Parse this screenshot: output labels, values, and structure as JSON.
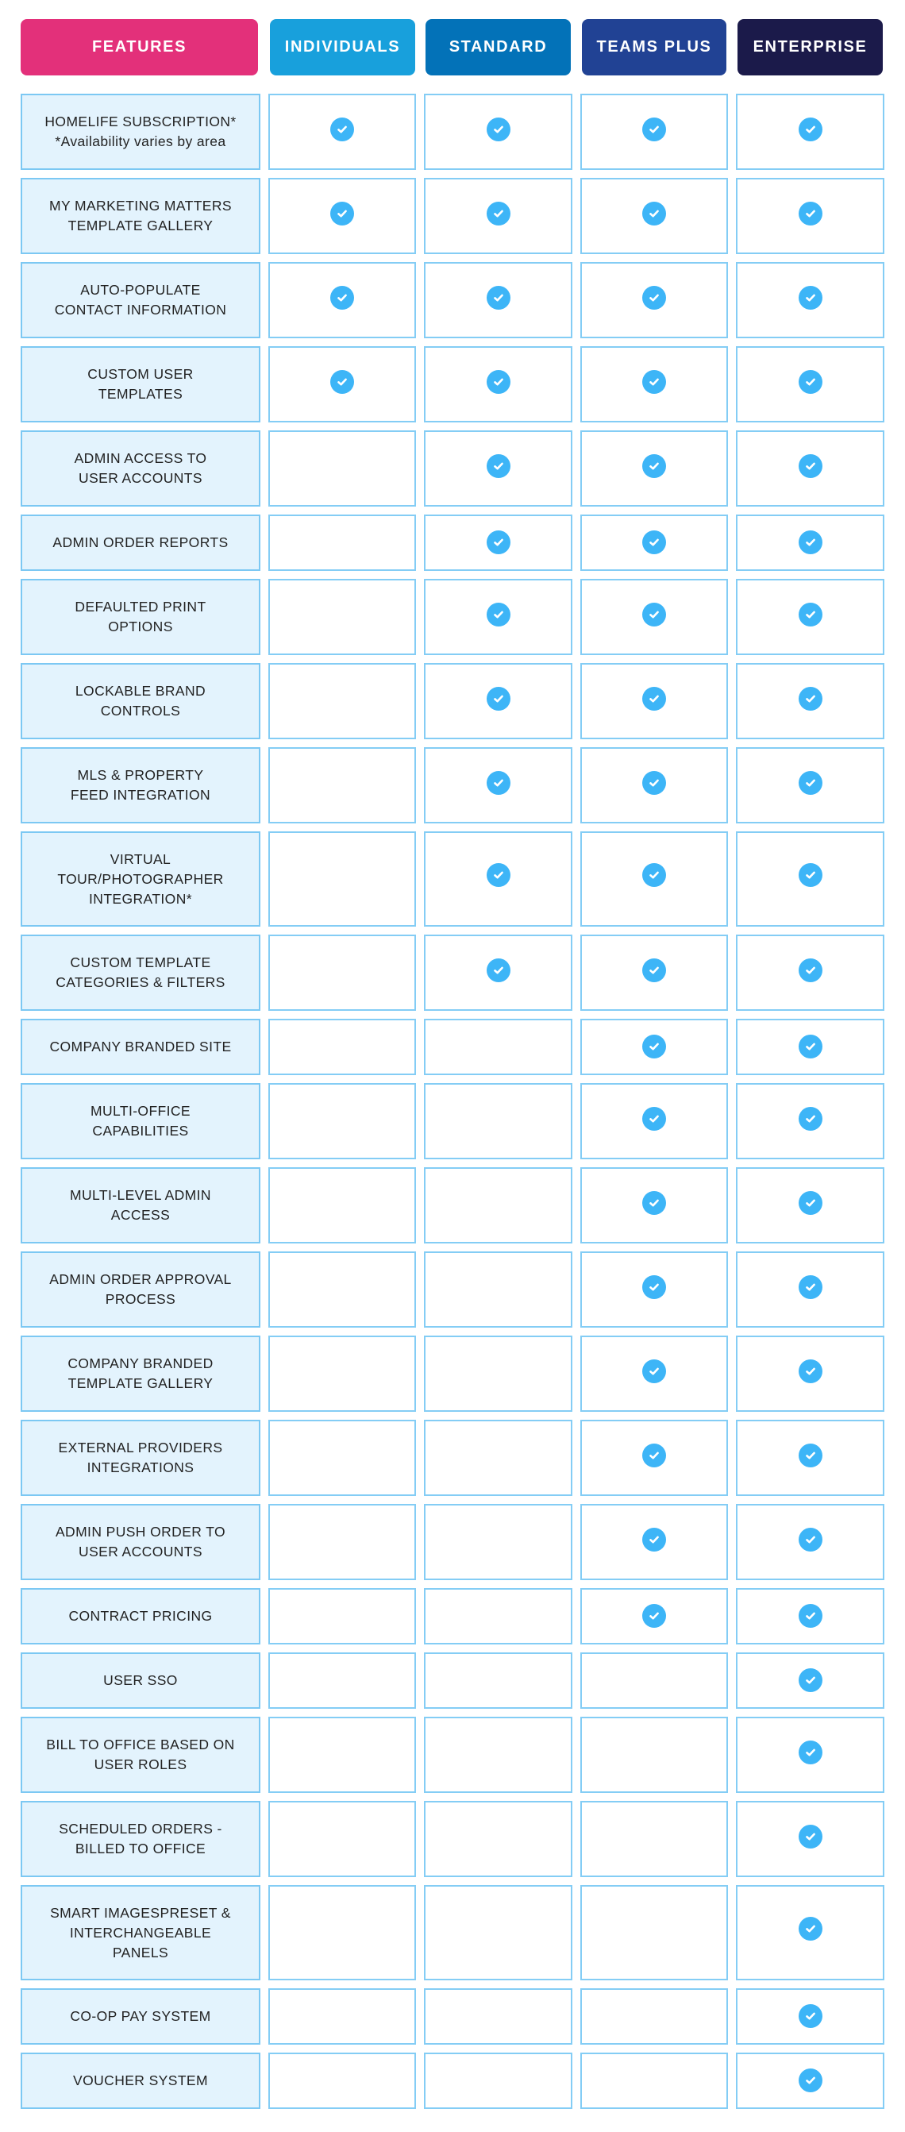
{
  "colors": {
    "features_header": "#e3307a",
    "individuals_header": "#18a0dc",
    "standard_header": "#0372b8",
    "teams_plus_header": "#214294",
    "enterprise_header": "#1b1a4a",
    "check": "#3db5f7",
    "cell_border": "#84cdf5",
    "feature_cell_bg": "#e3f3fd"
  },
  "header": {
    "features": "FEATURES",
    "plans": [
      "INDIVIDUALS",
      "STANDARD",
      "TEAMS PLUS",
      "ENTERPRISE"
    ]
  },
  "check_icon": "check-circle-icon",
  "rows": [
    {
      "lines": [
        "HOMELIFE SUBSCRIPTION*",
        "*Availability varies by area"
      ],
      "mixed_case_second": true,
      "included": [
        true,
        true,
        true,
        true
      ]
    },
    {
      "lines": [
        "MY MARKETING MATTERS",
        "TEMPLATE GALLERY"
      ],
      "included": [
        true,
        true,
        true,
        true
      ]
    },
    {
      "lines": [
        "AUTO-POPULATE",
        "CONTACT INFORMATION"
      ],
      "included": [
        true,
        true,
        true,
        true
      ]
    },
    {
      "lines": [
        "CUSTOM USER",
        "TEMPLATES"
      ],
      "included": [
        true,
        true,
        true,
        true
      ]
    },
    {
      "lines": [
        "ADMIN ACCESS TO",
        "USER ACCOUNTS"
      ],
      "included": [
        false,
        true,
        true,
        true
      ]
    },
    {
      "lines": [
        "ADMIN ORDER REPORTS"
      ],
      "included": [
        false,
        true,
        true,
        true
      ]
    },
    {
      "lines": [
        "DEFAULTED PRINT",
        "OPTIONS"
      ],
      "included": [
        false,
        true,
        true,
        true
      ]
    },
    {
      "lines": [
        "LOCKABLE BRAND",
        "CONTROLS"
      ],
      "included": [
        false,
        true,
        true,
        true
      ]
    },
    {
      "lines": [
        "MLS & PROPERTY",
        "FEED INTEGRATION"
      ],
      "included": [
        false,
        true,
        true,
        true
      ]
    },
    {
      "lines": [
        "VIRTUAL",
        "TOUR/PHOTOGRAPHER",
        "INTEGRATION*"
      ],
      "included": [
        false,
        true,
        true,
        true
      ]
    },
    {
      "lines": [
        "CUSTOM TEMPLATE",
        "CATEGORIES & FILTERS"
      ],
      "included": [
        false,
        true,
        true,
        true
      ]
    },
    {
      "lines": [
        "COMPANY BRANDED SITE"
      ],
      "included": [
        false,
        false,
        true,
        true
      ]
    },
    {
      "lines": [
        "MULTI-OFFICE",
        "CAPABILITIES"
      ],
      "included": [
        false,
        false,
        true,
        true
      ]
    },
    {
      "lines": [
        "MULTI-LEVEL ADMIN",
        "ACCESS"
      ],
      "included": [
        false,
        false,
        true,
        true
      ]
    },
    {
      "lines": [
        "ADMIN ORDER APPROVAL",
        "PROCESS"
      ],
      "included": [
        false,
        false,
        true,
        true
      ]
    },
    {
      "lines": [
        "COMPANY BRANDED",
        "TEMPLATE GALLERY"
      ],
      "included": [
        false,
        false,
        true,
        true
      ]
    },
    {
      "lines": [
        "EXTERNAL PROVIDERS",
        "INTEGRATIONS"
      ],
      "included": [
        false,
        false,
        true,
        true
      ]
    },
    {
      "lines": [
        "ADMIN PUSH ORDER TO",
        "USER ACCOUNTS"
      ],
      "included": [
        false,
        false,
        true,
        true
      ]
    },
    {
      "lines": [
        "CONTRACT PRICING"
      ],
      "included": [
        false,
        false,
        true,
        true
      ]
    },
    {
      "lines": [
        "USER SSO"
      ],
      "included": [
        false,
        false,
        false,
        true
      ]
    },
    {
      "lines": [
        "BILL TO OFFICE BASED ON",
        "USER ROLES"
      ],
      "included": [
        false,
        false,
        false,
        true
      ]
    },
    {
      "lines": [
        "SCHEDULED ORDERS -",
        "BILLED TO OFFICE"
      ],
      "included": [
        false,
        false,
        false,
        true
      ]
    },
    {
      "lines": [
        "SMART IMAGESPRESET &",
        "INTERCHANGEABLE",
        "PANELS"
      ],
      "included": [
        false,
        false,
        false,
        true
      ]
    },
    {
      "lines": [
        "CO-OP PAY SYSTEM"
      ],
      "included": [
        false,
        false,
        false,
        true
      ]
    },
    {
      "lines": [
        "VOUCHER SYSTEM"
      ],
      "included": [
        false,
        false,
        false,
        true
      ]
    }
  ]
}
